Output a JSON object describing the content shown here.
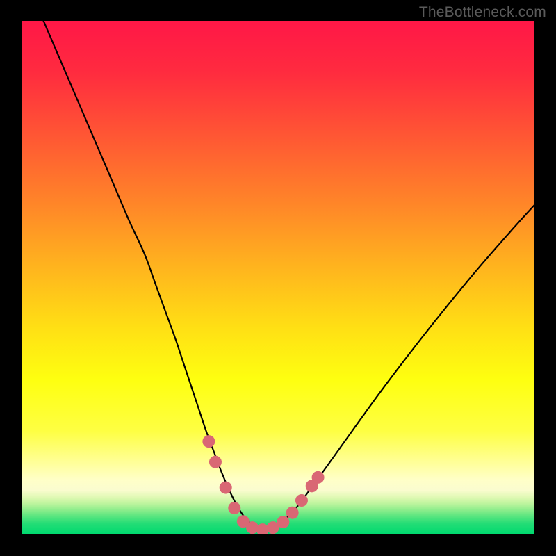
{
  "watermark": {
    "text": "TheBottleneck.com"
  },
  "gradient": {
    "stops": [
      {
        "offset": 0.0,
        "color": "#ff1747"
      },
      {
        "offset": 0.1,
        "color": "#ff2b3f"
      },
      {
        "offset": 0.22,
        "color": "#ff5534"
      },
      {
        "offset": 0.35,
        "color": "#ff8329"
      },
      {
        "offset": 0.48,
        "color": "#ffb41e"
      },
      {
        "offset": 0.6,
        "color": "#ffe014"
      },
      {
        "offset": 0.7,
        "color": "#feff10"
      },
      {
        "offset": 0.8,
        "color": "#feff43"
      },
      {
        "offset": 0.865,
        "color": "#ffff9e"
      },
      {
        "offset": 0.895,
        "color": "#ffffc8"
      },
      {
        "offset": 0.915,
        "color": "#fafccf"
      },
      {
        "offset": 0.928,
        "color": "#e1f9b5"
      },
      {
        "offset": 0.94,
        "color": "#c1f59f"
      },
      {
        "offset": 0.952,
        "color": "#94ee8e"
      },
      {
        "offset": 0.965,
        "color": "#5de680"
      },
      {
        "offset": 0.98,
        "color": "#24dd76"
      },
      {
        "offset": 1.0,
        "color": "#00d96f"
      }
    ]
  },
  "chart_data": {
    "type": "line",
    "title": "",
    "xlabel": "",
    "ylabel": "",
    "xlim": [
      0,
      100
    ],
    "ylim": [
      0,
      100
    ],
    "series": [
      {
        "name": "bottleneck-curve",
        "x": [
          3,
          6,
          9,
          12,
          15,
          18,
          21,
          24,
          26,
          28,
          30,
          31.5,
          33,
          34.5,
          36,
          37.5,
          39,
          40.5,
          42,
          43.5,
          45,
          46.5,
          48,
          50,
          53,
          56,
          60,
          65,
          70,
          76,
          82,
          89,
          96,
          100
        ],
        "values": [
          103,
          96,
          89,
          82,
          75,
          68,
          61,
          54.5,
          49,
          43.5,
          38,
          33.5,
          29,
          24.5,
          20,
          16,
          12,
          8.5,
          5.5,
          3.2,
          1.6,
          0.7,
          0.7,
          1.7,
          4.4,
          8.3,
          13.8,
          20.8,
          27.7,
          35.6,
          43.2,
          51.7,
          59.7,
          64.1
        ]
      }
    ],
    "highlight": {
      "name": "nadir-markers",
      "color": "#d96774",
      "points": [
        {
          "x": 36.5,
          "y": 18.0
        },
        {
          "x": 37.8,
          "y": 14.0
        },
        {
          "x": 39.8,
          "y": 9.0
        },
        {
          "x": 41.5,
          "y": 5.0
        },
        {
          "x": 43.2,
          "y": 2.4
        },
        {
          "x": 45.0,
          "y": 1.2
        },
        {
          "x": 47.0,
          "y": 0.8
        },
        {
          "x": 49.0,
          "y": 1.2
        },
        {
          "x": 51.0,
          "y": 2.3
        },
        {
          "x": 52.8,
          "y": 4.1
        },
        {
          "x": 54.6,
          "y": 6.5
        },
        {
          "x": 56.6,
          "y": 9.3
        },
        {
          "x": 57.8,
          "y": 11.0
        }
      ]
    }
  }
}
